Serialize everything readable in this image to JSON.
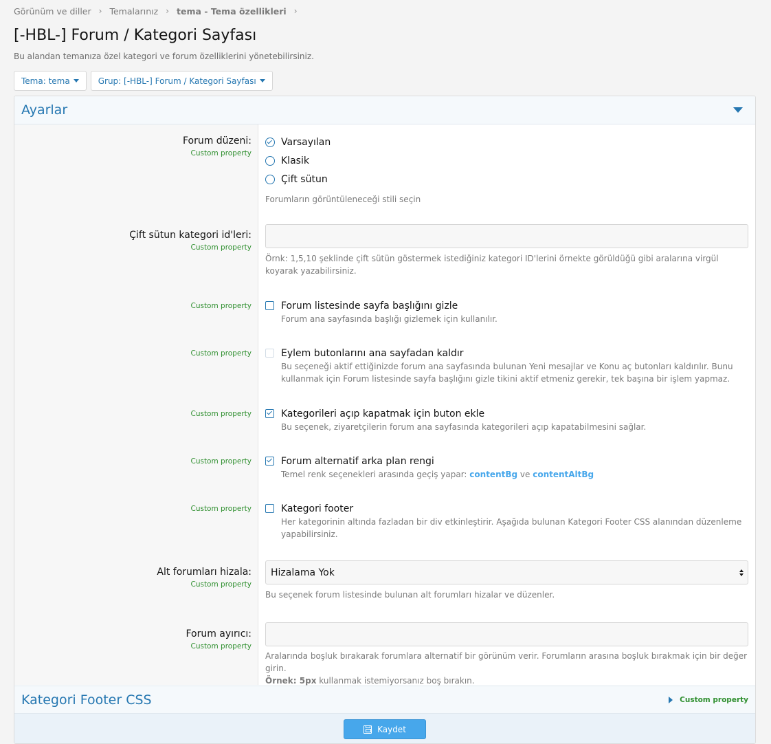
{
  "breadcrumb": [
    "Görünüm ve diller",
    "Temalarınız",
    "tema - Tema özellikleri"
  ],
  "page": {
    "title": "[-HBL-] Forum / Kategori Sayfası",
    "description": "Bu alandan temanıza özel kategori ve forum özelliklerini yönetebilirsiniz."
  },
  "filters": {
    "theme": "Tema: tema",
    "group": "Grup: [-HBL-] Forum / Kategori Sayfası"
  },
  "section": {
    "title": "Ayarlar"
  },
  "custom_property": "Custom property",
  "forum_layout": {
    "label": "Forum düzeni:",
    "options": [
      "Varsayılan",
      "Klasik",
      "Çift sütun"
    ],
    "selected": "Varsayılan",
    "hint": "Forumların görüntüleneceği stili seçin"
  },
  "double_column": {
    "label": "Çift sütun kategori id'leri:",
    "value": "",
    "hint": "Örnk: 1,5,10 şeklinde çift sütün göstermek istediğiniz kategori ID'lerini örnekte görüldüğü gibi aralarına virgül koyarak yazabilirsiniz."
  },
  "hide_title": {
    "title": "Forum listesinde sayfa başlığını gizle",
    "desc": "Forum ana sayfasında başlığı gizlemek için kullanılır.",
    "checked": false
  },
  "remove_actions": {
    "title": "Eylem butonlarını ana sayfadan kaldır",
    "desc": "Bu seçeneği aktif ettiğinizde forum ana sayfasında bulunan Yeni mesajlar ve Konu aç butonları kaldırılır. Bunu kullanmak için Forum listesinde sayfa başlığını gizle tikini aktif etmeniz gerekir, tek başına bir işlem yapmaz.",
    "checked": false
  },
  "collapse_button": {
    "title": "Kategorileri açıp kapatmak için buton ekle",
    "desc": "Bu seçenek, ziyaretçilerin forum ana sayfasında kategorileri açıp kapatabilmesini sağlar.",
    "checked": true
  },
  "alt_bg": {
    "title": "Forum alternatif arka plan rengi",
    "desc_prefix": "Temel renk seçenekleri arasında geçiş yapar: ",
    "link1": "contentBg",
    "conj": " ve ",
    "link2": "contentAltBg",
    "checked": true
  },
  "category_footer": {
    "title": "Kategori footer",
    "desc": "Her kategorinin altında fazladan bir div etkinleştirir. Aşağıda bulunan Kategori Footer CSS alanından düzenleme yapabilirsiniz.",
    "checked": false
  },
  "subforum_align": {
    "label": "Alt forumları hizala:",
    "value": "Hizalama Yok",
    "hint": "Bu seçenek forum listesinde bulunan alt forumları hizalar ve düzenler."
  },
  "forum_separator": {
    "label": "Forum ayırıcı:",
    "value": "",
    "hint": "Aralarında boşluk bırakarak forumlara alternatif bir görünüm verir. Forumların arasına boşluk bırakmak için bir değer girin.",
    "hint_bold": "Örnek: 5px",
    "hint_tail": " kullanmak istemiyorsanız boş bırakın."
  },
  "footer_css": {
    "title": "Kategori Footer CSS",
    "right_label": "Custom property"
  },
  "save_label": "Kaydet",
  "colors": {
    "accent": "#2577b1",
    "link": "#47a7eb",
    "custom_property": "#2f8f2f",
    "button": "#47a7eb"
  }
}
